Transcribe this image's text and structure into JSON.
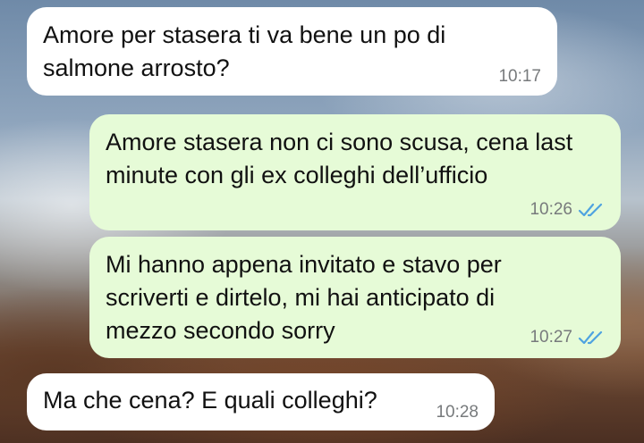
{
  "chat": {
    "messages": [
      {
        "direction": "incoming",
        "text": "Amore per stasera ti va bene un po di salmone arrosto?",
        "time": "10:17"
      },
      {
        "direction": "outgoing",
        "text": "Amore stasera non ci sono scusa, cena last minute con gli ex colleghi dell’ufficio",
        "time": "10:26",
        "status": "read",
        "status_icon": "double-check-icon"
      },
      {
        "direction": "outgoing",
        "text": "Mi hanno appena invitato e stavo per scriverti e dirtelo, mi hai anticipato di mezzo secondo sorry",
        "time": "10:27",
        "status": "read",
        "status_icon": "double-check-icon"
      },
      {
        "direction": "incoming",
        "text": "Ma che cena? E quali colleghi?",
        "time": "10:28"
      }
    ]
  },
  "colors": {
    "incoming_bubble": "#ffffff",
    "outgoing_bubble": "#e6fbd7",
    "read_tick": "#4fa3e0",
    "timestamp": "#777a7c"
  }
}
